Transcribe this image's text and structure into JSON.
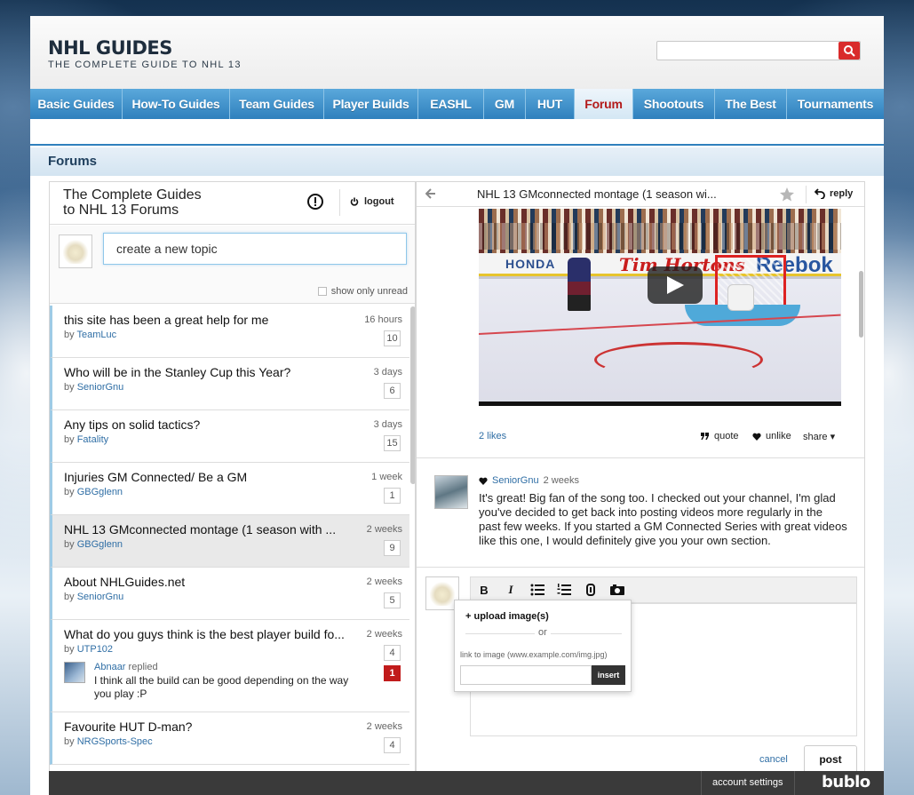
{
  "site": {
    "title": "NHL GUIDES",
    "tagline": "THE COMPLETE GUIDE TO NHL 13"
  },
  "search": {
    "placeholder": "",
    "value": ""
  },
  "nav": {
    "items": [
      {
        "label": "Basic Guides"
      },
      {
        "label": "How-To Guides"
      },
      {
        "label": "Team Guides"
      },
      {
        "label": "Player Builds"
      },
      {
        "label": "EASHL"
      },
      {
        "label": "GM"
      },
      {
        "label": "HUT"
      },
      {
        "label": "Forum"
      },
      {
        "label": "Shootouts"
      },
      {
        "label": "The Best"
      },
      {
        "label": "Tournaments"
      }
    ],
    "active": "Forum"
  },
  "forums_bar": {
    "title": "Forums"
  },
  "left_panel": {
    "title_line1": "The Complete Guides",
    "title_line2": "to NHL 13 Forums",
    "logout_label": "logout",
    "new_topic_placeholder": "create a new topic",
    "show_unread_label": "show only unread",
    "topics": [
      {
        "title": "this site has been a great help for me",
        "by_prefix": "by",
        "author": "TeamLuc",
        "time": "16 hours",
        "count": "10"
      },
      {
        "title": "Who will be in the Stanley Cup this Year?",
        "by_prefix": "by",
        "author": "SeniorGnu",
        "time": "3 days",
        "count": "6"
      },
      {
        "title": "Any tips on solid tactics?",
        "by_prefix": "by",
        "author": "Fatality",
        "time": "3 days",
        "count": "15"
      },
      {
        "title": "Injuries GM Connected/ Be a GM",
        "by_prefix": "by",
        "author": "GBGglenn",
        "time": "1 week",
        "count": "1"
      },
      {
        "title": "NHL 13 GMconnected montage (1 season with ...",
        "by_prefix": "by",
        "author": "GBGglenn",
        "time": "2 weeks",
        "count": "9"
      },
      {
        "title": "About NHLGuides.net",
        "by_prefix": "by",
        "author": "SeniorGnu",
        "time": "2 weeks",
        "count": "5"
      },
      {
        "title": "What do you guys think is the best player build fo...",
        "by_prefix": "by",
        "author": "UTP102",
        "time": "2 weeks",
        "count": "4",
        "reply": {
          "user": "Abnaar",
          "action": "replied",
          "text": "I think all the build can be good depending on the way you play :P",
          "new_count": "1"
        }
      },
      {
        "title": "Favourite HUT D-man?",
        "by_prefix": "by",
        "author": "NRGSports-Spec",
        "time": "2 weeks",
        "count": "4"
      }
    ]
  },
  "thread": {
    "title": "NHL 13 GMconnected montage (1 season wi...",
    "reply_label": "reply",
    "video": {
      "board_1": "HONDA",
      "board_2": "Tim Hortons",
      "board_3": "Reebok"
    },
    "actions": {
      "likes": "2 likes",
      "quote": "quote",
      "unlike": "unlike",
      "share": "share ▾"
    },
    "comment": {
      "user": "SeniorGnu",
      "time": "2 weeks",
      "text": "It's great! Big fan of the song too. I checked out your channel, I'm glad you've decided to get back into posting videos more regularly in the past few weeks. If you started a GM Connected Series with great videos like this one, I would definitely give you your own section."
    },
    "composer": {
      "toolbar": {
        "bold": "B",
        "italic": "I"
      },
      "popup": {
        "upload_label": "upload image(s)",
        "or_label": "or",
        "link_label": "link to image (www.example.com/img.jpg)",
        "insert_label": "insert"
      },
      "cancel_label": "cancel",
      "post_label": "post"
    }
  },
  "bottom_bar": {
    "account_label": "account settings",
    "logo": "bublo"
  },
  "colors": {
    "nav_blue": "#2f80bd",
    "active_red": "#b31b1b",
    "link_blue": "#2f6ea5",
    "badge_red": "#c11b1b"
  }
}
